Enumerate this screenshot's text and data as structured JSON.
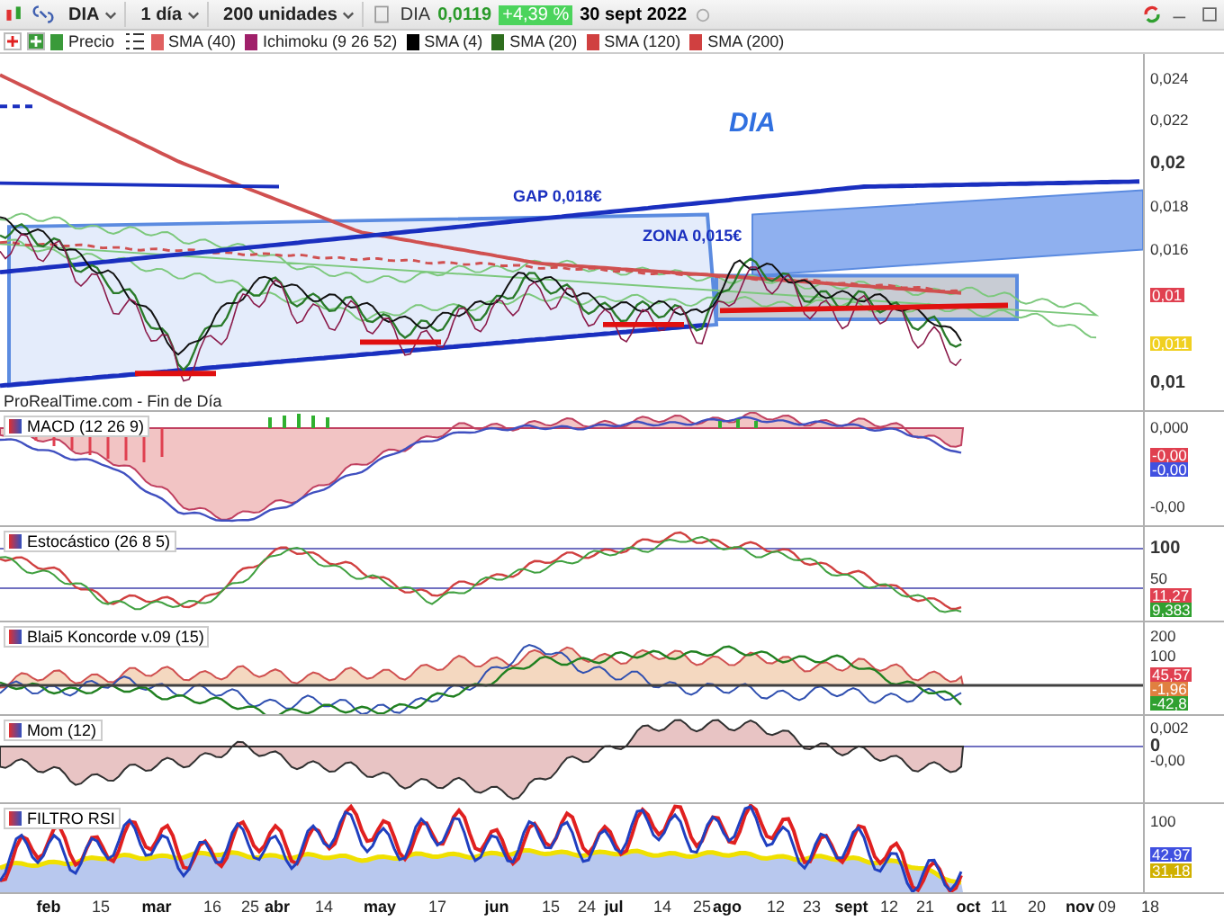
{
  "toolbar": {
    "ticker": "DIA",
    "timeframe": "1 día",
    "units": "200 unidades",
    "quote_name": "DIA",
    "price": "0,0119",
    "change": "+4,39 %",
    "date": "30 sept 2022"
  },
  "legend": [
    {
      "label": "Precio",
      "color": "#3a9a3a"
    },
    {
      "label": "SMA (40)",
      "color": "#e06060"
    },
    {
      "label": "Ichimoku (9 26 52)",
      "color": "#a0206a"
    },
    {
      "label": "SMA (4)",
      "color": "#000000"
    },
    {
      "label": "SMA (20)",
      "color": "#2e6e1e"
    },
    {
      "label": "SMA (120)",
      "color": "#d04040"
    },
    {
      "label": "SMA (200)",
      "color": "#d04040"
    }
  ],
  "panels": [
    {
      "annotations": [
        {
          "kind": "title",
          "text": "DIA"
        },
        {
          "kind": "gap",
          "text": "GAP 0,018€"
        },
        {
          "kind": "zone",
          "text": "ZONA 0,015€"
        }
      ],
      "footer": "ProRealTime.com - Fin de Día",
      "axis": [
        {
          "text": "0,024",
          "kind": "plain"
        },
        {
          "text": "0,022",
          "kind": "plain"
        },
        {
          "text": "0,02",
          "kind": "bold"
        },
        {
          "text": "0,018",
          "kind": "plain"
        },
        {
          "text": "0,016",
          "kind": "plain"
        },
        {
          "text": "0,01",
          "kind": "tag",
          "color": "#e04050"
        },
        {
          "text": "0,011",
          "kind": "tag",
          "color": "#f0d020"
        },
        {
          "text": "0,01",
          "kind": "bold"
        }
      ]
    },
    {
      "label": "MACD (12 26 9)",
      "axis": [
        {
          "text": "0,000",
          "kind": "plain"
        },
        {
          "text": "-0,00",
          "kind": "tag",
          "color": "#e04050"
        },
        {
          "text": "-0,00",
          "kind": "tag",
          "color": "#4050e0"
        },
        {
          "text": "-0,00",
          "kind": "plain"
        }
      ]
    },
    {
      "label": "Estocástico (26 8 5)",
      "axis": [
        {
          "text": "100",
          "kind": "bold"
        },
        {
          "text": "50",
          "kind": "plain"
        },
        {
          "text": "11,27",
          "kind": "tag",
          "color": "#e04050"
        },
        {
          "text": "9,383",
          "kind": "tag",
          "color": "#30a030"
        }
      ]
    },
    {
      "label": "Blai5 Koncorde v.09 (15)",
      "axis": [
        {
          "text": "200",
          "kind": "plain"
        },
        {
          "text": "100",
          "kind": "plain"
        },
        {
          "text": "45,57",
          "kind": "tag",
          "color": "#e04050"
        },
        {
          "text": "-1,96",
          "kind": "tag",
          "color": "#e08040"
        },
        {
          "text": "-42,8",
          "kind": "tag",
          "color": "#30a030"
        }
      ]
    },
    {
      "label": "Mom (12)",
      "axis": [
        {
          "text": "0,002",
          "kind": "plain"
        },
        {
          "text": "0",
          "kind": "bold"
        },
        {
          "text": "-0,00",
          "kind": "plain"
        }
      ]
    },
    {
      "label": "FILTRO RSI",
      "axis": [
        {
          "text": "100",
          "kind": "plain"
        },
        {
          "text": "42,97",
          "kind": "tag",
          "color": "#4050e0"
        },
        {
          "text": "31,18",
          "kind": "tag",
          "color": "#d0b000"
        }
      ]
    }
  ],
  "x_axis": [
    {
      "text": "feb",
      "bold": true
    },
    {
      "text": "15",
      "bold": false
    },
    {
      "text": "mar",
      "bold": true
    },
    {
      "text": "16",
      "bold": false
    },
    {
      "text": "25",
      "bold": false
    },
    {
      "text": "abr",
      "bold": true
    },
    {
      "text": "14",
      "bold": false
    },
    {
      "text": "may",
      "bold": true
    },
    {
      "text": "17",
      "bold": false
    },
    {
      "text": "jun",
      "bold": true
    },
    {
      "text": "15",
      "bold": false
    },
    {
      "text": "24",
      "bold": false
    },
    {
      "text": "jul",
      "bold": true
    },
    {
      "text": "14",
      "bold": false
    },
    {
      "text": "25",
      "bold": false
    },
    {
      "text": "ago",
      "bold": true
    },
    {
      "text": "12",
      "bold": false
    },
    {
      "text": "23",
      "bold": false
    },
    {
      "text": "sept",
      "bold": true
    },
    {
      "text": "12",
      "bold": false
    },
    {
      "text": "21",
      "bold": false
    },
    {
      "text": "oct",
      "bold": true
    },
    {
      "text": "11",
      "bold": false
    },
    {
      "text": "20",
      "bold": false
    },
    {
      "text": "nov",
      "bold": true
    },
    {
      "text": "09",
      "bold": false
    },
    {
      "text": "18",
      "bold": false
    }
  ]
}
